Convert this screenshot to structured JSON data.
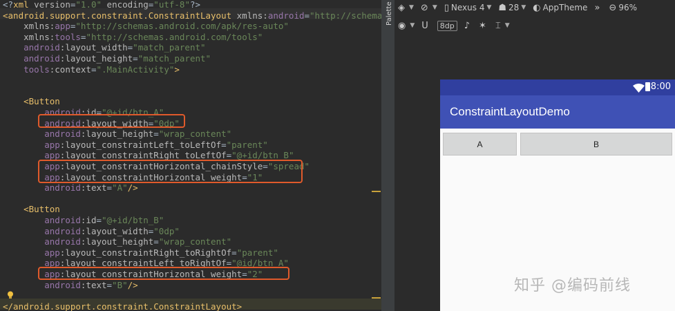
{
  "editor": {
    "lines": [
      [
        [
          "punc",
          "<?"
        ],
        [
          "tag",
          "xml "
        ],
        [
          "attr",
          "version"
        ],
        [
          "punc",
          "="
        ],
        [
          "val",
          "\"1.0\" "
        ],
        [
          "attr",
          "encoding"
        ],
        [
          "punc",
          "="
        ],
        [
          "val",
          "\"utf-8\""
        ],
        [
          "punc",
          "?>"
        ]
      ],
      [
        [
          "tag",
          "<android.support.constraint.ConstraintLayout "
        ],
        [
          "attr",
          "xmlns:"
        ],
        [
          "ns",
          "android"
        ],
        [
          "punc",
          "="
        ],
        [
          "val",
          "\"http://schemas."
        ]
      ],
      [
        [
          "punc",
          "    "
        ],
        [
          "attr",
          "xmlns:"
        ],
        [
          "ns",
          "app"
        ],
        [
          "punc",
          "="
        ],
        [
          "val",
          "\"http://schemas.android.com/apk/res-auto\""
        ]
      ],
      [
        [
          "punc",
          "    "
        ],
        [
          "attr",
          "xmlns:"
        ],
        [
          "ns",
          "tools"
        ],
        [
          "punc",
          "="
        ],
        [
          "val",
          "\"http://schemas.android.com/tools\""
        ]
      ],
      [
        [
          "punc",
          "    "
        ],
        [
          "ns",
          "android"
        ],
        [
          "attr",
          ":layout_width"
        ],
        [
          "punc",
          "="
        ],
        [
          "val",
          "\"match_parent\""
        ]
      ],
      [
        [
          "punc",
          "    "
        ],
        [
          "ns",
          "android"
        ],
        [
          "attr",
          ":layout_height"
        ],
        [
          "punc",
          "="
        ],
        [
          "val",
          "\"match_parent\""
        ]
      ],
      [
        [
          "punc",
          "    "
        ],
        [
          "ns",
          "tools"
        ],
        [
          "attr",
          ":context"
        ],
        [
          "punc",
          "="
        ],
        [
          "val",
          "\".MainActivity\""
        ],
        [
          "tag",
          ">"
        ]
      ],
      [],
      [],
      [
        [
          "punc",
          "    "
        ],
        [
          "tag",
          "<Button"
        ]
      ],
      [
        [
          "punc",
          "        "
        ],
        [
          "ns",
          "android"
        ],
        [
          "attr",
          ":id"
        ],
        [
          "punc",
          "="
        ],
        [
          "val",
          "\"@+id/btn_A\""
        ]
      ],
      [
        [
          "punc",
          "        "
        ],
        [
          "ns",
          "android"
        ],
        [
          "attr",
          ":layout_width"
        ],
        [
          "punc",
          "="
        ],
        [
          "val",
          "\"0dp\""
        ]
      ],
      [
        [
          "punc",
          "        "
        ],
        [
          "ns",
          "android"
        ],
        [
          "attr",
          ":layout_height"
        ],
        [
          "punc",
          "="
        ],
        [
          "val",
          "\"wrap_content\""
        ]
      ],
      [
        [
          "punc",
          "        "
        ],
        [
          "ns",
          "app"
        ],
        [
          "attr",
          ":layout_constraintLeft_toLeftOf"
        ],
        [
          "punc",
          "="
        ],
        [
          "val",
          "\"parent\""
        ]
      ],
      [
        [
          "punc",
          "        "
        ],
        [
          "ns",
          "app"
        ],
        [
          "attr",
          ":layout_constraintRight_toLeftOf"
        ],
        [
          "punc",
          "="
        ],
        [
          "val",
          "\"@+id/btn_B\""
        ]
      ],
      [
        [
          "punc",
          "        "
        ],
        [
          "ns",
          "app"
        ],
        [
          "attr",
          ":layout_constraintHorizontal_chainStyle"
        ],
        [
          "punc",
          "="
        ],
        [
          "val",
          "\"spread\""
        ]
      ],
      [
        [
          "punc",
          "        "
        ],
        [
          "ns",
          "app"
        ],
        [
          "attr",
          ":layout_constraintHorizontal_weight"
        ],
        [
          "punc",
          "="
        ],
        [
          "val",
          "\"1\""
        ]
      ],
      [
        [
          "punc",
          "        "
        ],
        [
          "ns",
          "android"
        ],
        [
          "attr",
          ":text"
        ],
        [
          "punc",
          "="
        ],
        [
          "val",
          "\"A\""
        ],
        [
          "tag",
          "/>"
        ]
      ],
      [],
      [
        [
          "punc",
          "    "
        ],
        [
          "tag",
          "<Button"
        ]
      ],
      [
        [
          "punc",
          "        "
        ],
        [
          "ns",
          "android"
        ],
        [
          "attr",
          ":id"
        ],
        [
          "punc",
          "="
        ],
        [
          "val",
          "\"@+id/btn_B\""
        ]
      ],
      [
        [
          "punc",
          "        "
        ],
        [
          "ns",
          "android"
        ],
        [
          "attr",
          ":layout_width"
        ],
        [
          "punc",
          "="
        ],
        [
          "val",
          "\"0dp\""
        ]
      ],
      [
        [
          "punc",
          "        "
        ],
        [
          "ns",
          "android"
        ],
        [
          "attr",
          ":layout_height"
        ],
        [
          "punc",
          "="
        ],
        [
          "val",
          "\"wrap_content\""
        ]
      ],
      [
        [
          "punc",
          "        "
        ],
        [
          "ns",
          "app"
        ],
        [
          "attr",
          ":layout_constraintRight_toRightOf"
        ],
        [
          "punc",
          "="
        ],
        [
          "val",
          "\"parent\""
        ]
      ],
      [
        [
          "punc",
          "        "
        ],
        [
          "ns",
          "app"
        ],
        [
          "attr",
          ":layout_constraintLeft_toRightOf"
        ],
        [
          "punc",
          "="
        ],
        [
          "val",
          "\"@id/btn_A\""
        ]
      ],
      [
        [
          "punc",
          "        "
        ],
        [
          "ns",
          "app"
        ],
        [
          "attr",
          ":layout_constraintHorizontal_weight"
        ],
        [
          "punc",
          "="
        ],
        [
          "val",
          "\"2\""
        ]
      ],
      [
        [
          "punc",
          "        "
        ],
        [
          "ns",
          "android"
        ],
        [
          "attr",
          ":text"
        ],
        [
          "punc",
          "="
        ],
        [
          "val",
          "\"B\""
        ],
        [
          "tag",
          "/>"
        ]
      ],
      [],
      [
        [
          "tag",
          "</android.support.constraint.ConstraintLayout>"
        ]
      ]
    ]
  },
  "palette": {
    "label": "Palette"
  },
  "toolbar1": {
    "device": "Nexus 4",
    "api": "28",
    "theme": "AppTheme",
    "zoom": "96%"
  },
  "toolbar2": {
    "margin": "8dp"
  },
  "device": {
    "time": "8:00",
    "app_title": "ConstraintLayoutDemo",
    "button_a": "A",
    "button_b": "B"
  },
  "watermark": "知乎 @编码前线"
}
